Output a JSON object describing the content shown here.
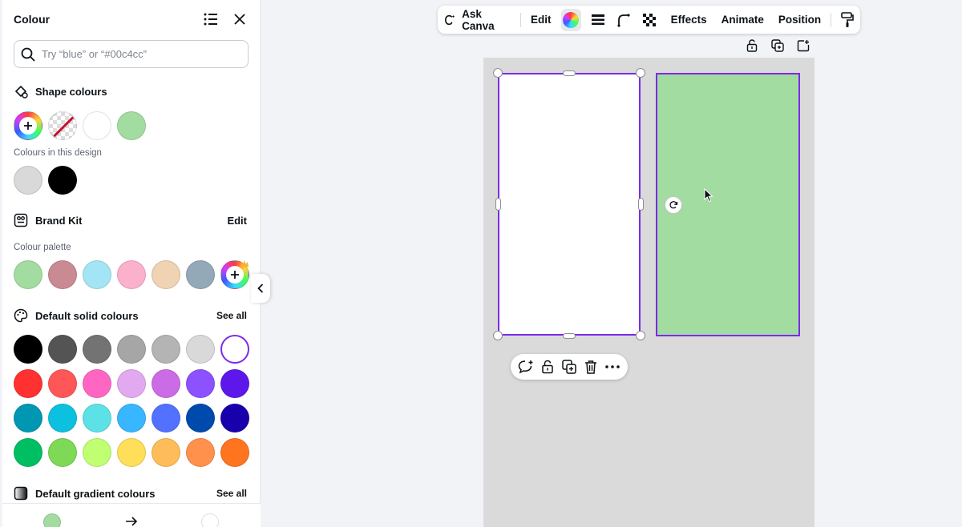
{
  "panel": {
    "title": "Colour",
    "search_placeholder": "Try “blue” or “#00c4cc”",
    "shape_colours": {
      "heading": "Shape colours",
      "swatches": [
        "add-color",
        "transparent",
        "#ffffff",
        "#a3dca0"
      ]
    },
    "in_design": {
      "label": "Colours in this design",
      "swatches": [
        "#d9d9d9",
        "#000000"
      ]
    },
    "brand_kit": {
      "heading": "Brand Kit",
      "edit_label": "Edit",
      "palette_label": "Colour palette",
      "swatches": [
        "#a3dca0",
        "#c98a94",
        "#a3e4f5",
        "#fbb0cc",
        "#f0d3b3",
        "#93a9b8"
      ]
    },
    "default_solid": {
      "heading": "Default solid colours",
      "see_all": "See all",
      "rows": [
        [
          "#000000",
          "#545454",
          "#737373",
          "#a6a6a6",
          "#b4b4b4",
          "#d9d9d9",
          "#ffffff"
        ],
        [
          "#ff3131",
          "#ff5757",
          "#ff66c4",
          "#e2a9f1",
          "#cb6ce6",
          "#8c52ff",
          "#5e17eb"
        ],
        [
          "#0097b2",
          "#0cc0df",
          "#5ce1e6",
          "#38b6ff",
          "#5271ff",
          "#004aad",
          "#1800ad"
        ],
        [
          "#00bf63",
          "#7ed957",
          "#c1ff72",
          "#ffde59",
          "#ffbd59",
          "#ff914d",
          "#ff751f"
        ]
      ]
    },
    "default_gradient": {
      "heading": "Default gradient colours",
      "see_all": "See all"
    },
    "footer": {
      "from_color": "#a3dca0",
      "arrow_icon": "arrow-right-icon",
      "to_color": "#ffffff"
    }
  },
  "toolbar": {
    "ask_canva": "Ask Canva",
    "edit": "Edit",
    "effects": "Effects",
    "animate": "Animate",
    "position": "Position"
  },
  "canvas": {
    "page_bg": "#dadada",
    "frame_left_fill": "#ffffff",
    "frame_right_fill": "#a3dca0",
    "selection_color": "#7d2ae8"
  }
}
